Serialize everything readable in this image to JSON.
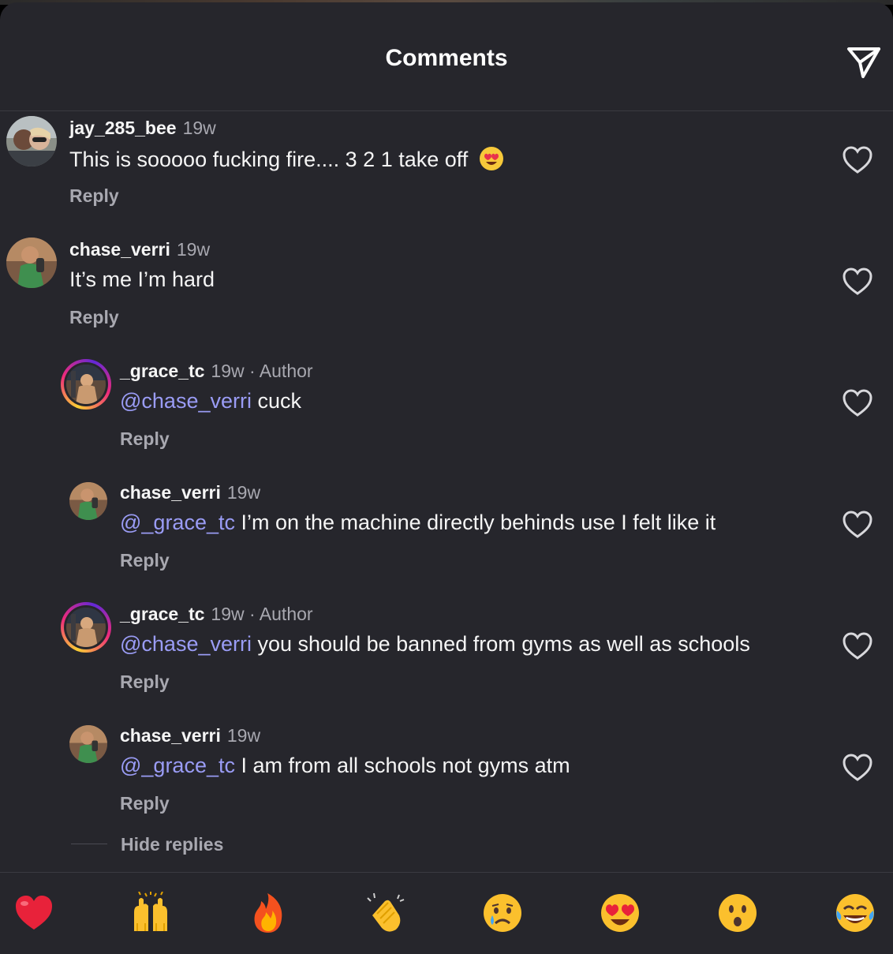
{
  "header": {
    "title": "Comments",
    "share_icon": "paper-plane-icon"
  },
  "comments": [
    {
      "username": "jay_285_bee",
      "time": "19w",
      "author": "",
      "mention": "",
      "text": "This is sooooo fucking fire.... 3 2 1 take off",
      "emoji": "heart-eyes-emoji",
      "reply": "Reply"
    },
    {
      "username": "chase_verri",
      "time": "19w",
      "author": "",
      "mention": "",
      "text": "It’s me I’m hard",
      "reply": "Reply"
    },
    {
      "username": "_grace_tc",
      "time": "19w",
      "author": " · Author",
      "mention": "@chase_verri",
      "text": " cuck",
      "reply": "Reply"
    },
    {
      "username": "chase_verri",
      "time": "19w",
      "author": "",
      "mention": "@_grace_tc",
      "text": " I’m on the machine directly behinds use I felt like it",
      "reply": "Reply"
    },
    {
      "username": "_grace_tc",
      "time": "19w",
      "author": " · Author",
      "mention": "@chase_verri",
      "text": " you should be banned from gyms as well as schools",
      "reply": "Reply"
    },
    {
      "username": "chase_verri",
      "time": "19w",
      "author": "",
      "mention": "@_grace_tc",
      "text": " I am from all schools not gyms atm",
      "reply": "Reply"
    }
  ],
  "hide_replies": "Hide replies",
  "reactions": [
    "red-heart-emoji",
    "raised-hands-emoji",
    "fire-emoji",
    "clapping-hands-emoji",
    "crying-face-emoji",
    "heart-eyes-emoji",
    "surprised-face-emoji",
    "tears-of-joy-emoji"
  ],
  "colors": {
    "background": "#26262c",
    "mention": "#9a9cf5",
    "muted": "#a8a8b0"
  }
}
